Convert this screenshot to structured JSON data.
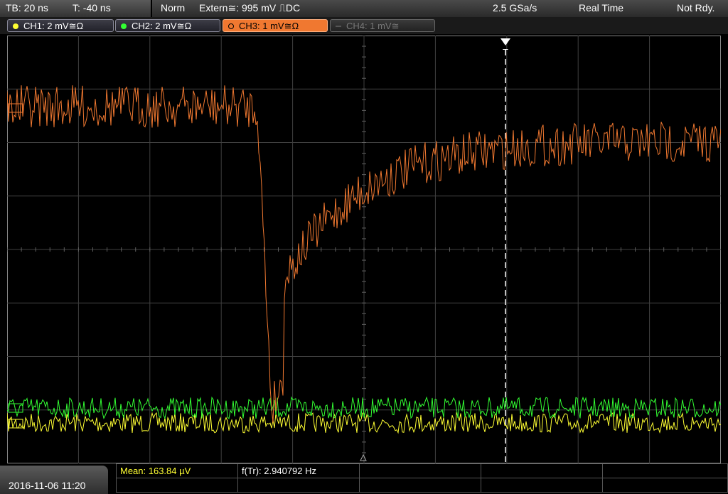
{
  "topbar": {
    "timebase": "TB: 20 ns",
    "trigger_time": "T: -40 ns",
    "mode": "Norm",
    "trigger_source": "Extern≅: 995 mV ⎍DC",
    "sample_rate": "2.5 GSa/s",
    "acq_mode": "Real Time",
    "status": "Not Rdy."
  },
  "channels": [
    {
      "label": "CH1: 2 mV≅Ω",
      "color": "#ffff33"
    },
    {
      "label": "CH2: 2 mV≅Ω",
      "color": "#33ff33"
    },
    {
      "label": "CH3: 1 mV≅Ω",
      "color": "#f07830"
    },
    {
      "label": "CH4: 1 mV≅",
      "color": "#666666"
    }
  ],
  "trigger_marker": "T",
  "bottom": {
    "datetime": "2016-11-06 11:20",
    "mean": "Mean: 163.84 µV",
    "freq": "f(Tr): 2.940792 Hz"
  }
}
